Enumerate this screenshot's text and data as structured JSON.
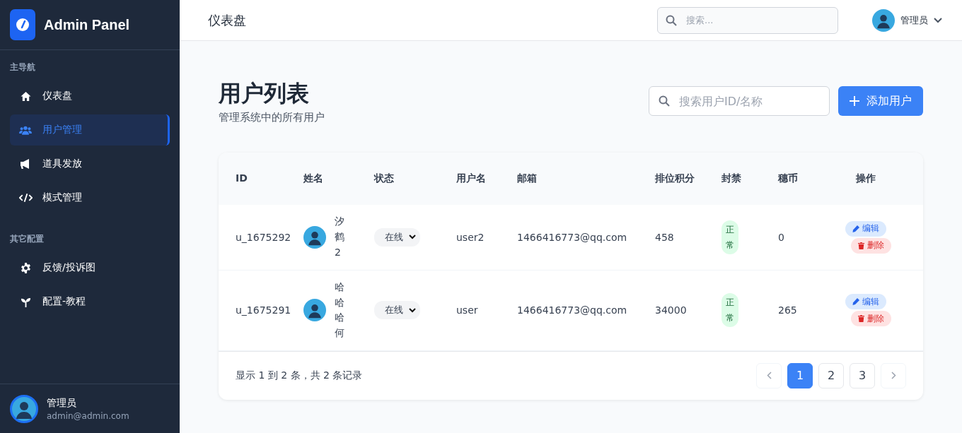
{
  "sidebar": {
    "brand": "Admin Panel",
    "sections": [
      {
        "label": "主导航",
        "items": [
          {
            "label": "仪表盘",
            "selected": false
          },
          {
            "label": "用户管理",
            "selected": true
          },
          {
            "label": "道具发放",
            "selected": false
          },
          {
            "label": "模式管理",
            "selected": false
          }
        ]
      },
      {
        "label": "其它配置",
        "items": [
          {
            "label": "反馈/投诉图",
            "selected": false
          },
          {
            "label": "配置-教程",
            "selected": false
          }
        ]
      }
    ],
    "user": {
      "name": "管理员",
      "email": "admin@admin.com"
    }
  },
  "header": {
    "title": "仪表盘",
    "search": {
      "placeholder": "搜索..."
    },
    "user_name": "管理员"
  },
  "page": {
    "title": "用户列表",
    "subtitle": "管理系统中的所有用户",
    "search": {
      "placeholder": "搜索用户ID/名称"
    },
    "add_button": "添加用户"
  },
  "table": {
    "columns": [
      "ID",
      "姓名",
      "状态",
      "用户名",
      "邮箱",
      "排位积分",
      "封禁",
      "穗币",
      "操作"
    ],
    "rows": [
      {
        "id": "u_1675292",
        "name": "汐鹤2",
        "status": "在线",
        "username": "user2",
        "email": "1466416773@qq.com",
        "rank_score": "458",
        "ban": "正常",
        "coins": "0",
        "actions": [
          "编辑",
          "删除"
        ]
      },
      {
        "id": "u_1675291",
        "name": "哈哈哈何",
        "status": "在线",
        "username": "user",
        "email": "1466416773@qq.com",
        "rank_score": "34000",
        "ban": "正常",
        "coins": "265",
        "actions": [
          "编辑",
          "删除"
        ]
      }
    ]
  },
  "footer": {
    "summary": "显示 1 到 2 条，共 2 条记录",
    "pages": [
      {
        "label": "1",
        "selected": true
      },
      {
        "label": "2",
        "selected": false
      },
      {
        "label": "3",
        "selected": false
      }
    ]
  }
}
